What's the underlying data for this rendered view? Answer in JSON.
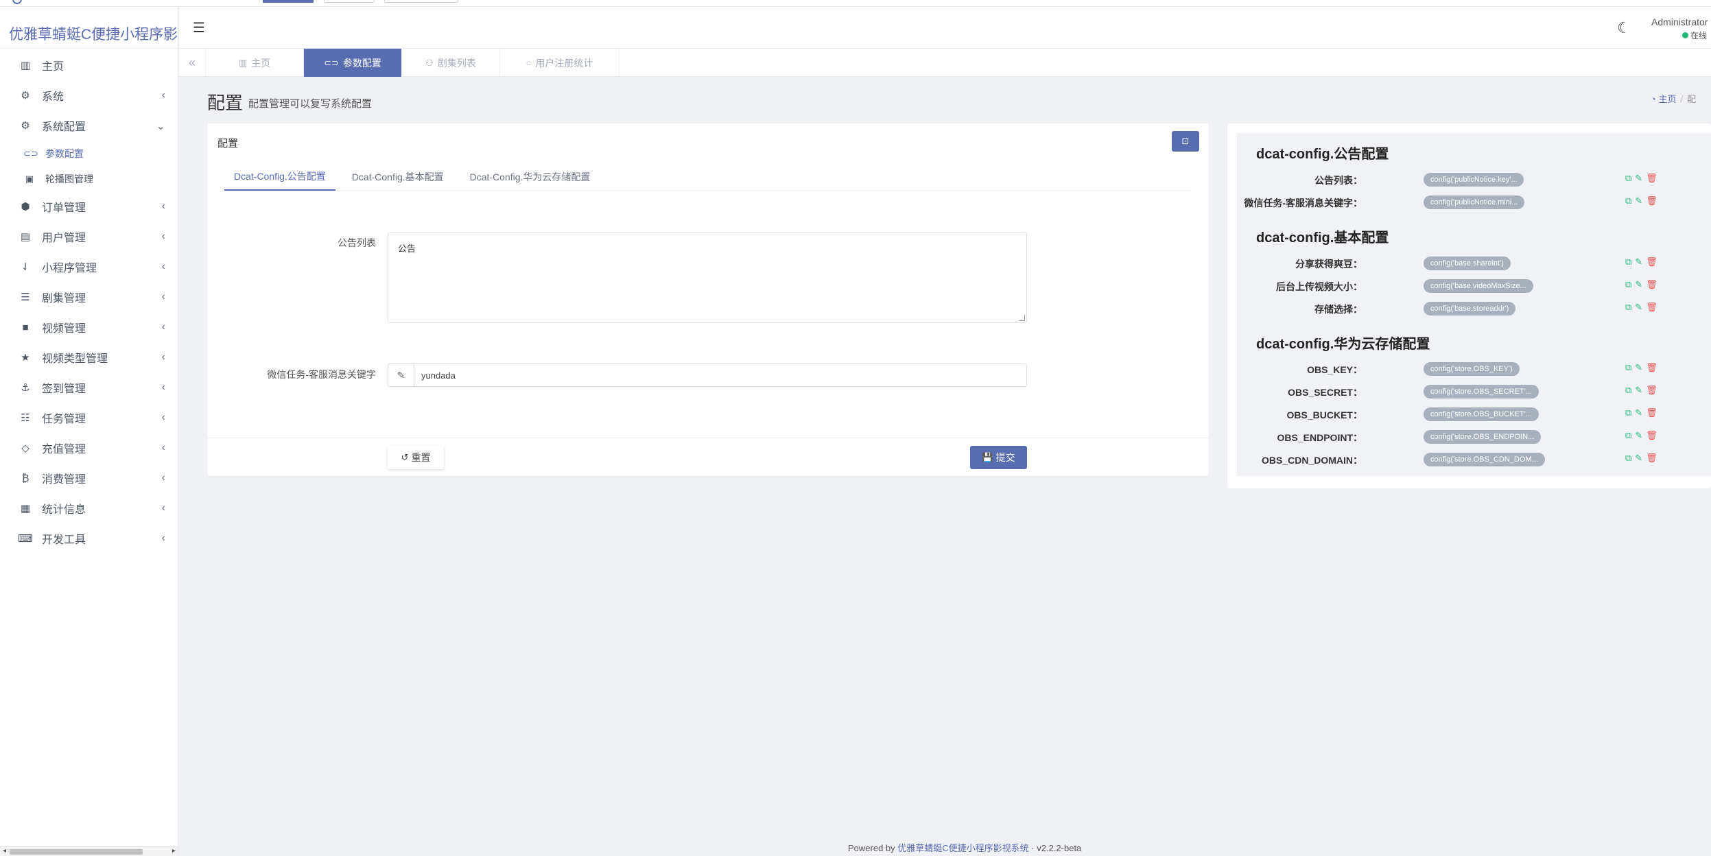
{
  "app": {
    "brand": "优雅草蜻蜓C便捷小程序影视"
  },
  "sidebar": {
    "items": [
      {
        "label": "主页",
        "icon": "bar-chart-icon"
      },
      {
        "label": "系统",
        "icon": "gear-icon",
        "chevron": "‹"
      },
      {
        "label": "系统配置",
        "icon": "gears-icon",
        "chevron": "⌄"
      },
      {
        "label": "参数配置",
        "icon": "toggle-icon",
        "sub": true,
        "active": true
      },
      {
        "label": "轮播图管理",
        "icon": "image-icon",
        "sub": true
      },
      {
        "label": "订单管理",
        "icon": "cube-icon",
        "chevron": "‹"
      },
      {
        "label": "用户管理",
        "icon": "contact-icon",
        "chevron": "‹"
      },
      {
        "label": "小程序管理",
        "icon": "sort-icon",
        "chevron": "‹"
      },
      {
        "label": "剧集管理",
        "icon": "list-icon",
        "chevron": "‹"
      },
      {
        "label": "视频管理",
        "icon": "video-icon",
        "chevron": "‹"
      },
      {
        "label": "视频类型管理",
        "icon": "star-icon",
        "chevron": "‹"
      },
      {
        "label": "签到管理",
        "icon": "anchor-icon",
        "chevron": "‹"
      },
      {
        "label": "任务管理",
        "icon": "tasks-icon",
        "chevron": "‹"
      },
      {
        "label": "充值管理",
        "icon": "diamond-icon",
        "chevron": "‹"
      },
      {
        "label": "消费管理",
        "icon": "bitcoin-icon",
        "chevron": "‹"
      },
      {
        "label": "统计信息",
        "icon": "chart-icon",
        "chevron": "‹"
      },
      {
        "label": "开发工具",
        "icon": "keyboard-icon",
        "chevron": "‹"
      }
    ]
  },
  "header": {
    "user_name": "Administrator",
    "user_status": "在线"
  },
  "tabs": [
    {
      "label": "主页",
      "icon": "bar-chart-icon"
    },
    {
      "label": "参数配置",
      "icon": "toggle-icon",
      "active": true
    },
    {
      "label": "剧集列表",
      "icon": "users-icon"
    },
    {
      "label": "用户注册统计",
      "icon": "circle-icon"
    }
  ],
  "page": {
    "title": "配置",
    "description": "配置管理可以复写系统配置",
    "breadcrumb": {
      "home": "主页",
      "current": "配"
    }
  },
  "card": {
    "title": "配置",
    "form_tabs": [
      "Dcat-Config.公告配置",
      "Dcat-Config.基本配置",
      "Dcat-Config.华为云存储配置"
    ],
    "fields": {
      "notice_label": "公告列表",
      "notice_value": "公告",
      "keyword_label": "微信任务-客服消息关键字",
      "keyword_value": "yundada"
    },
    "reset_label": "重置",
    "submit_label": "提交"
  },
  "right_panel": {
    "groups": [
      {
        "title": "dcat-config.公告配置",
        "rows": [
          {
            "label": "公告列表：",
            "code": "config('publicNotice.key'..."
          },
          {
            "label": "微信任务-客服消息关键字：",
            "code": "config('publicNotice.mini..."
          }
        ]
      },
      {
        "title": "dcat-config.基本配置",
        "rows": [
          {
            "label": "分享获得爽豆：",
            "code": "config('base.shareint')"
          },
          {
            "label": "后台上传视频大小：",
            "code": "config('base.videoMaxSize..."
          },
          {
            "label": "存储选择：",
            "code": "config('base.storeaddr')"
          }
        ]
      },
      {
        "title": "dcat-config.华为云存储配置",
        "rows": [
          {
            "label": "OBS_KEY：",
            "code": "config('store.OBS_KEY')"
          },
          {
            "label": "OBS_SECRET：",
            "code": "config('store.OBS_SECRET'..."
          },
          {
            "label": "OBS_BUCKET：",
            "code": "config('store.OBS_BUCKET'..."
          },
          {
            "label": "OBS_ENDPOINT：",
            "code": "config('store.OBS_ENDPOIN..."
          },
          {
            "label": "OBS_CDN_DOMAIN：",
            "code": "config('store.OBS_CDN_DOM..."
          }
        ]
      }
    ]
  },
  "footer": {
    "prefix": "Powered by",
    "link": "优雅草蜻蜓C便捷小程序影视系统",
    "version": "· v2.2.2-beta"
  },
  "colors": {
    "primary": "#586cb1",
    "success": "#21b978",
    "danger": "#ea5455",
    "background": "#eff1f5"
  }
}
